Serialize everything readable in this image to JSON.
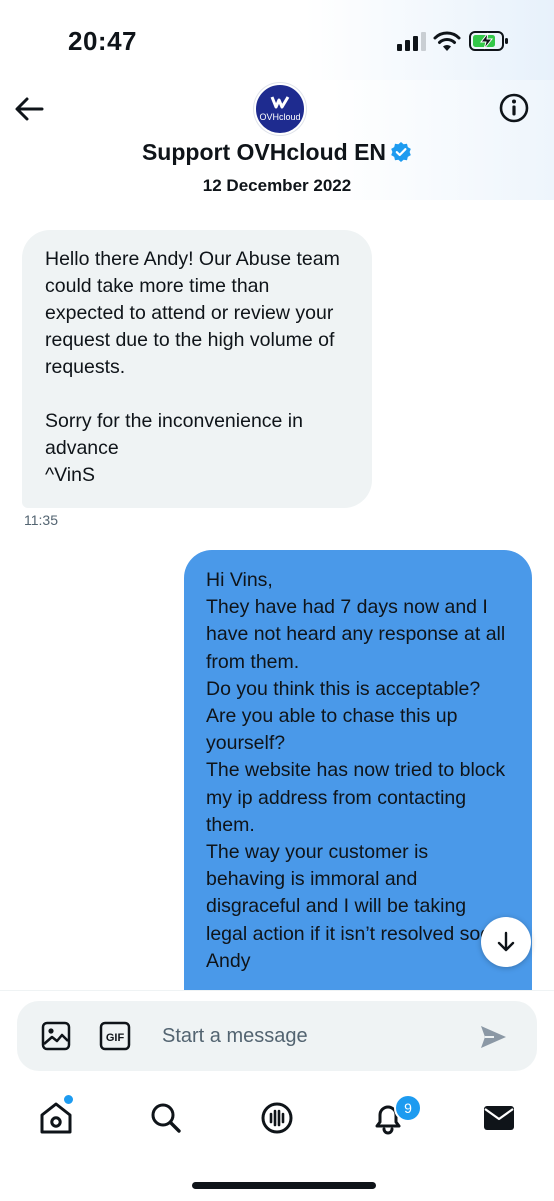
{
  "status_bar": {
    "time": "20:47"
  },
  "header": {
    "contact_name": "Support OVHcloud EN",
    "avatar_text": "OVHcloud",
    "date": "12 December 2022"
  },
  "messages": [
    {
      "direction": "incoming",
      "text": "Hello there Andy! Our Abuse team could take more time than expected to attend or review your request due to the high volume of requests.\n\nSorry for the inconvenience in advance\n^VinS",
      "time": "11:35"
    },
    {
      "direction": "outgoing",
      "text": "Hi Vins,\nThey have had 7 days now and I have not heard any response at all from them.\nDo you think this is acceptable? Are you able to chase this up yourself?\nThe website has now tried to block my ip address from contacting them.\nThe way your customer is behaving is immoral and disgraceful and I will be taking legal action if it isn’t resolved soon.\nAndy"
    }
  ],
  "composer": {
    "placeholder": "Start a message"
  },
  "tab_bar": {
    "items": [
      {
        "icon": "home-icon"
      },
      {
        "icon": "search-icon"
      },
      {
        "icon": "spaces-icon"
      },
      {
        "icon": "notifications-icon",
        "badge": "9"
      },
      {
        "icon": "messages-icon"
      }
    ]
  },
  "colors": {
    "accent": "#1d9bf0",
    "outgoing_bubble": "#4a99e9",
    "incoming_bubble": "#eff3f4",
    "avatar_bg": "#1e2b8f"
  }
}
